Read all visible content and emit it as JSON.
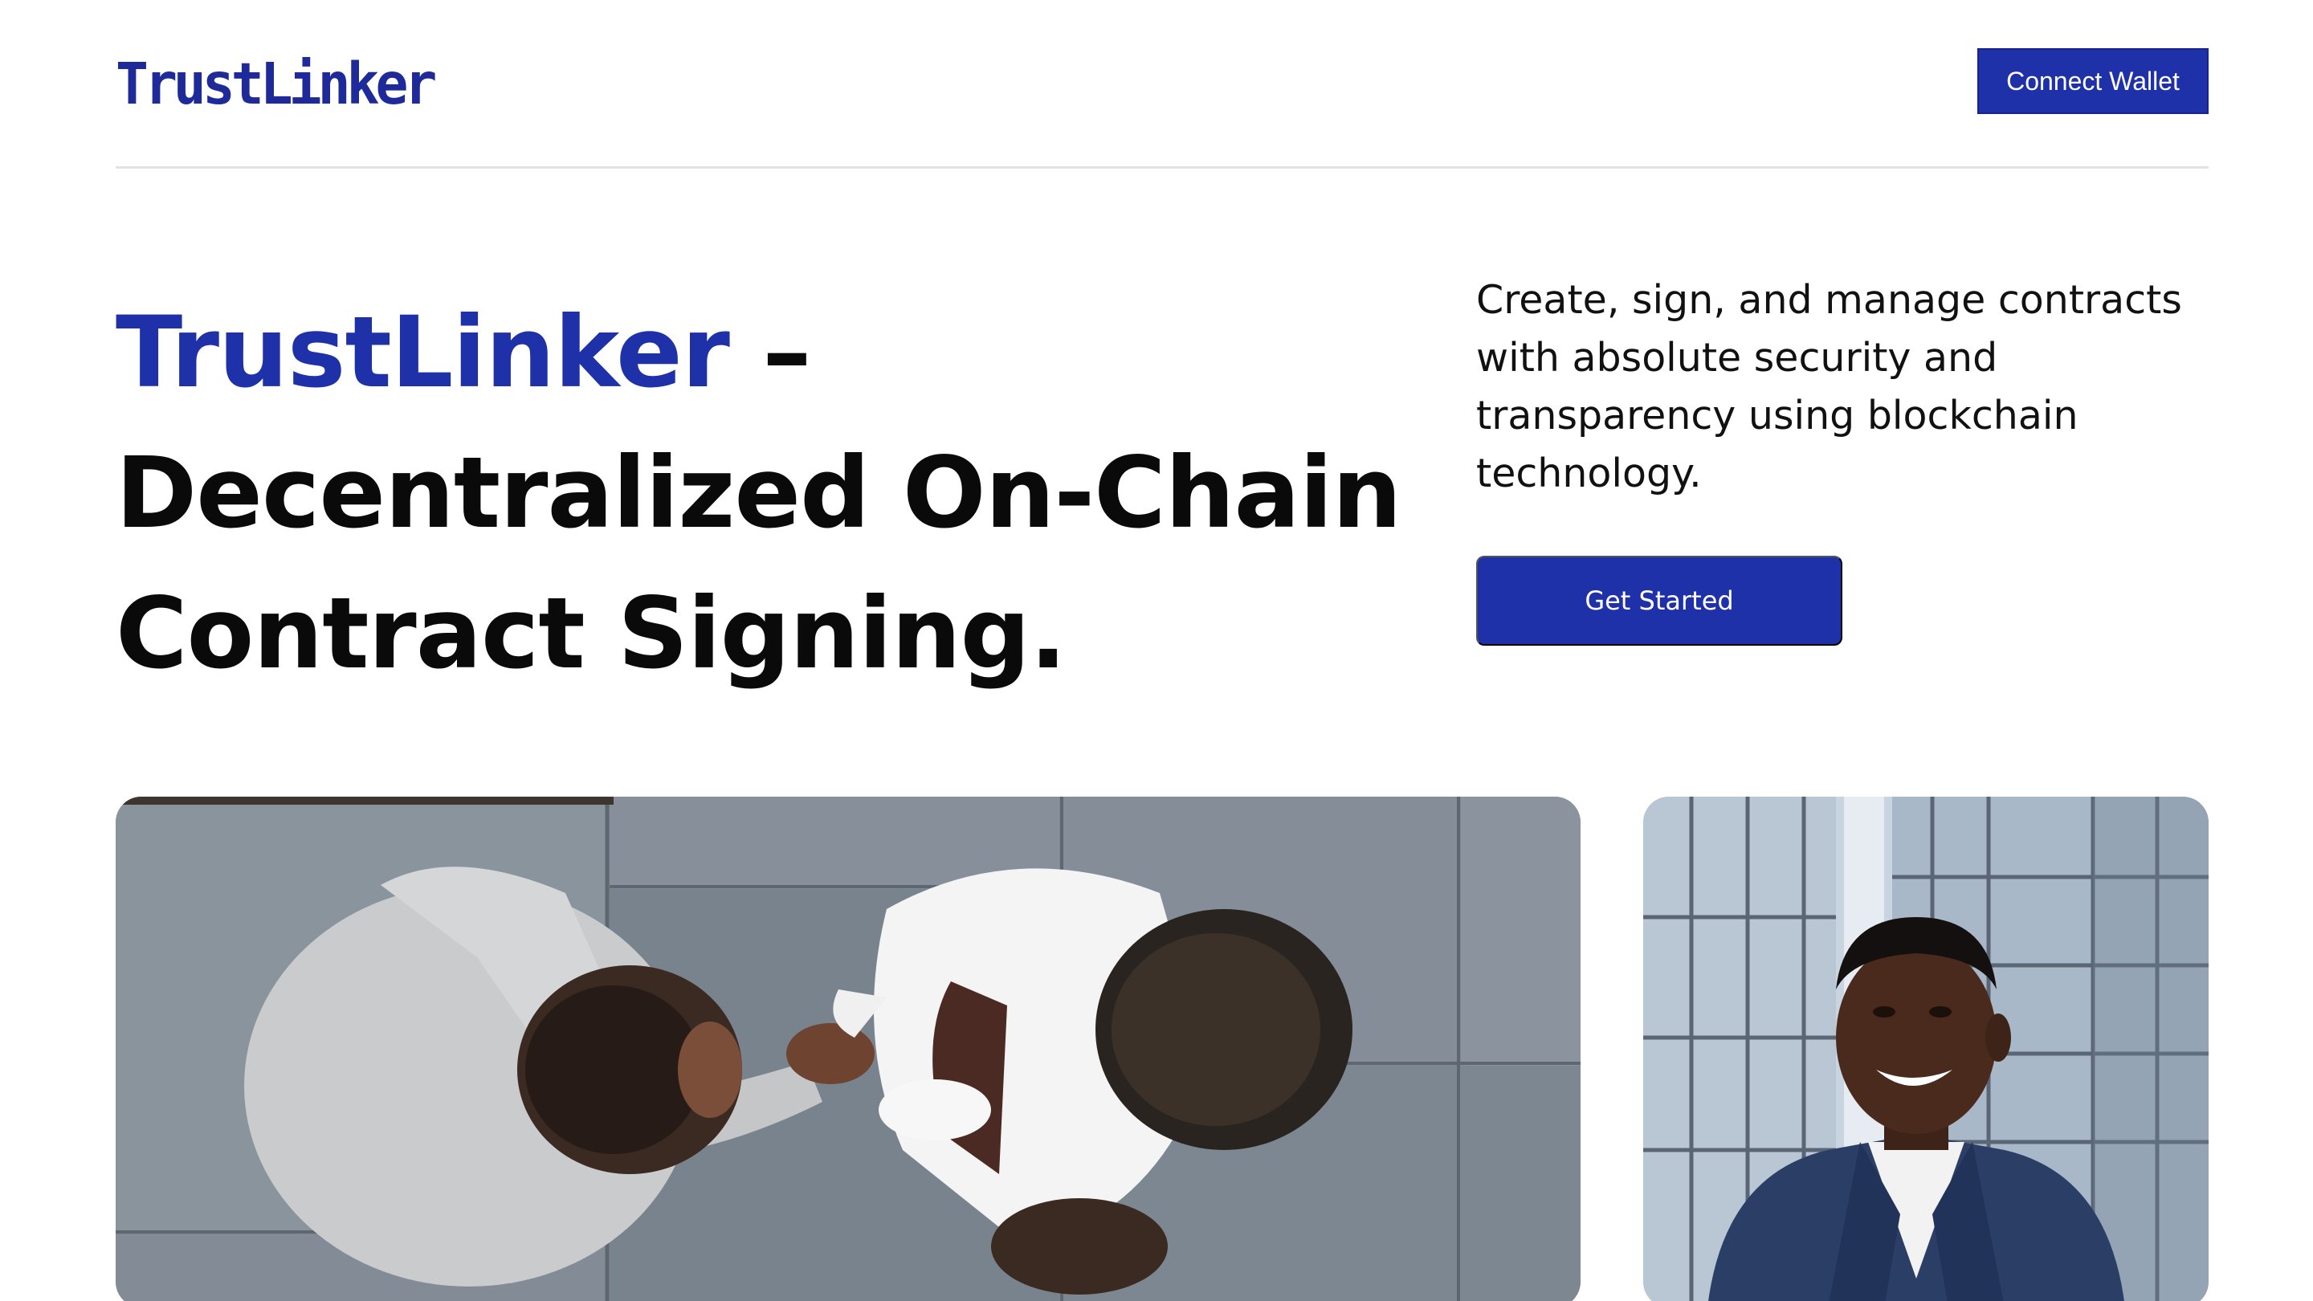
{
  "header": {
    "logo_text": "TrustLinker",
    "connect_wallet_label": "Connect Wallet"
  },
  "hero": {
    "headline_brand": "TrustLinker",
    "headline_rest": " – Decentralized On-Chain Contract Signing.",
    "description": "Create, sign, and manage contracts with absolute security and transparency using blockchain technology.",
    "cta_label": "Get Started"
  },
  "images": {
    "handshake_icon": "handshake-photo",
    "portrait_icon": "businessman-portrait-photo"
  },
  "colors": {
    "brand_blue": "#1f31a8",
    "logo_blue": "#1e2a9a",
    "text_dark": "#0a0a0a"
  }
}
